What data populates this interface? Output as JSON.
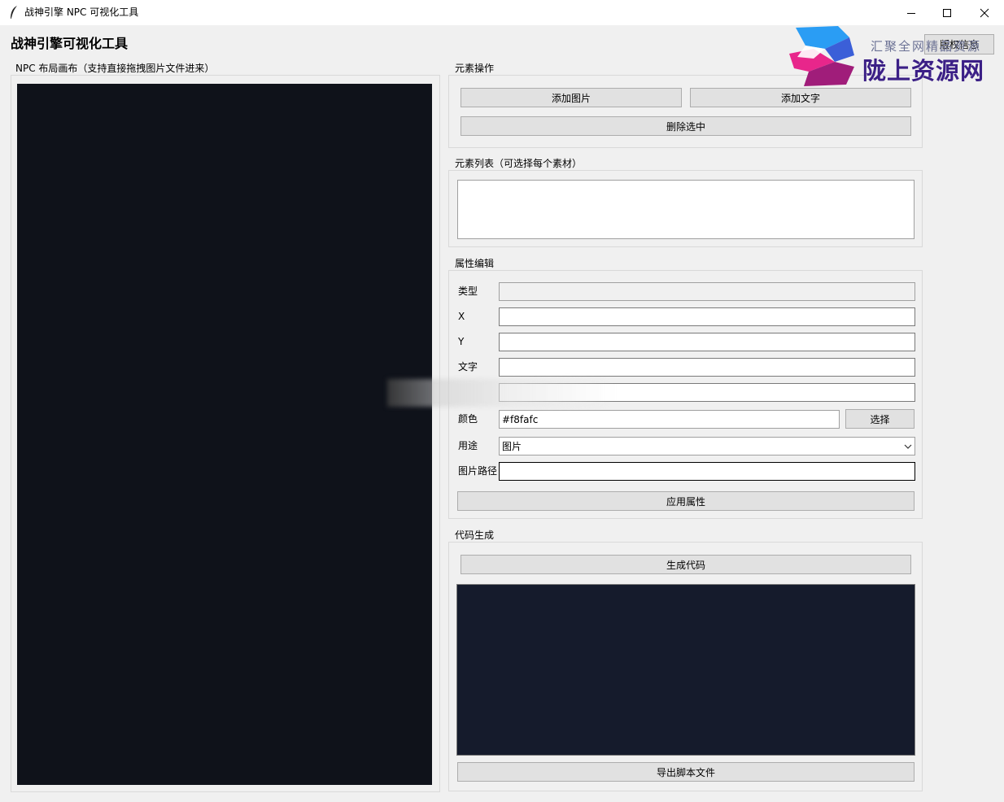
{
  "window": {
    "title": "战神引擎 NPC 可视化工具"
  },
  "header": {
    "title": "战神引擎可视化工具",
    "auth_button_label": "版权信息"
  },
  "canvas_group": {
    "label": "NPC 布局画布（支持直接拖拽图片文件进来）"
  },
  "elements_ops": {
    "label": "元素操作",
    "add_image": "添加图片",
    "add_text": "添加文字",
    "delete_selected": "删除选中"
  },
  "element_list": {
    "label": "元素列表（可选择每个素材）",
    "items": []
  },
  "properties": {
    "label": "属性编辑",
    "type_label": "类型",
    "type_value": "",
    "x_label": "X",
    "x_value": "",
    "y_label": "Y",
    "y_value": "",
    "text_label": "文字",
    "text_value": "",
    "size_value": "",
    "color_label": "颜色",
    "color_value": "#f8fafc",
    "color_pick": "选择",
    "usage_label": "用途",
    "usage_value": "图片",
    "image_path_label": "图片路径",
    "image_path_value": "",
    "apply": "应用属性"
  },
  "codegen": {
    "label": "代码生成",
    "generate": "生成代码",
    "export": "导出脚本文件"
  },
  "watermark": {
    "tagline": "汇聚全网精品资源",
    "site": "陇上资源网"
  },
  "colors": {
    "canvas_bg": "#0f121a",
    "code_bg": "#151b2c",
    "window_bg": "#f0f0f0"
  }
}
